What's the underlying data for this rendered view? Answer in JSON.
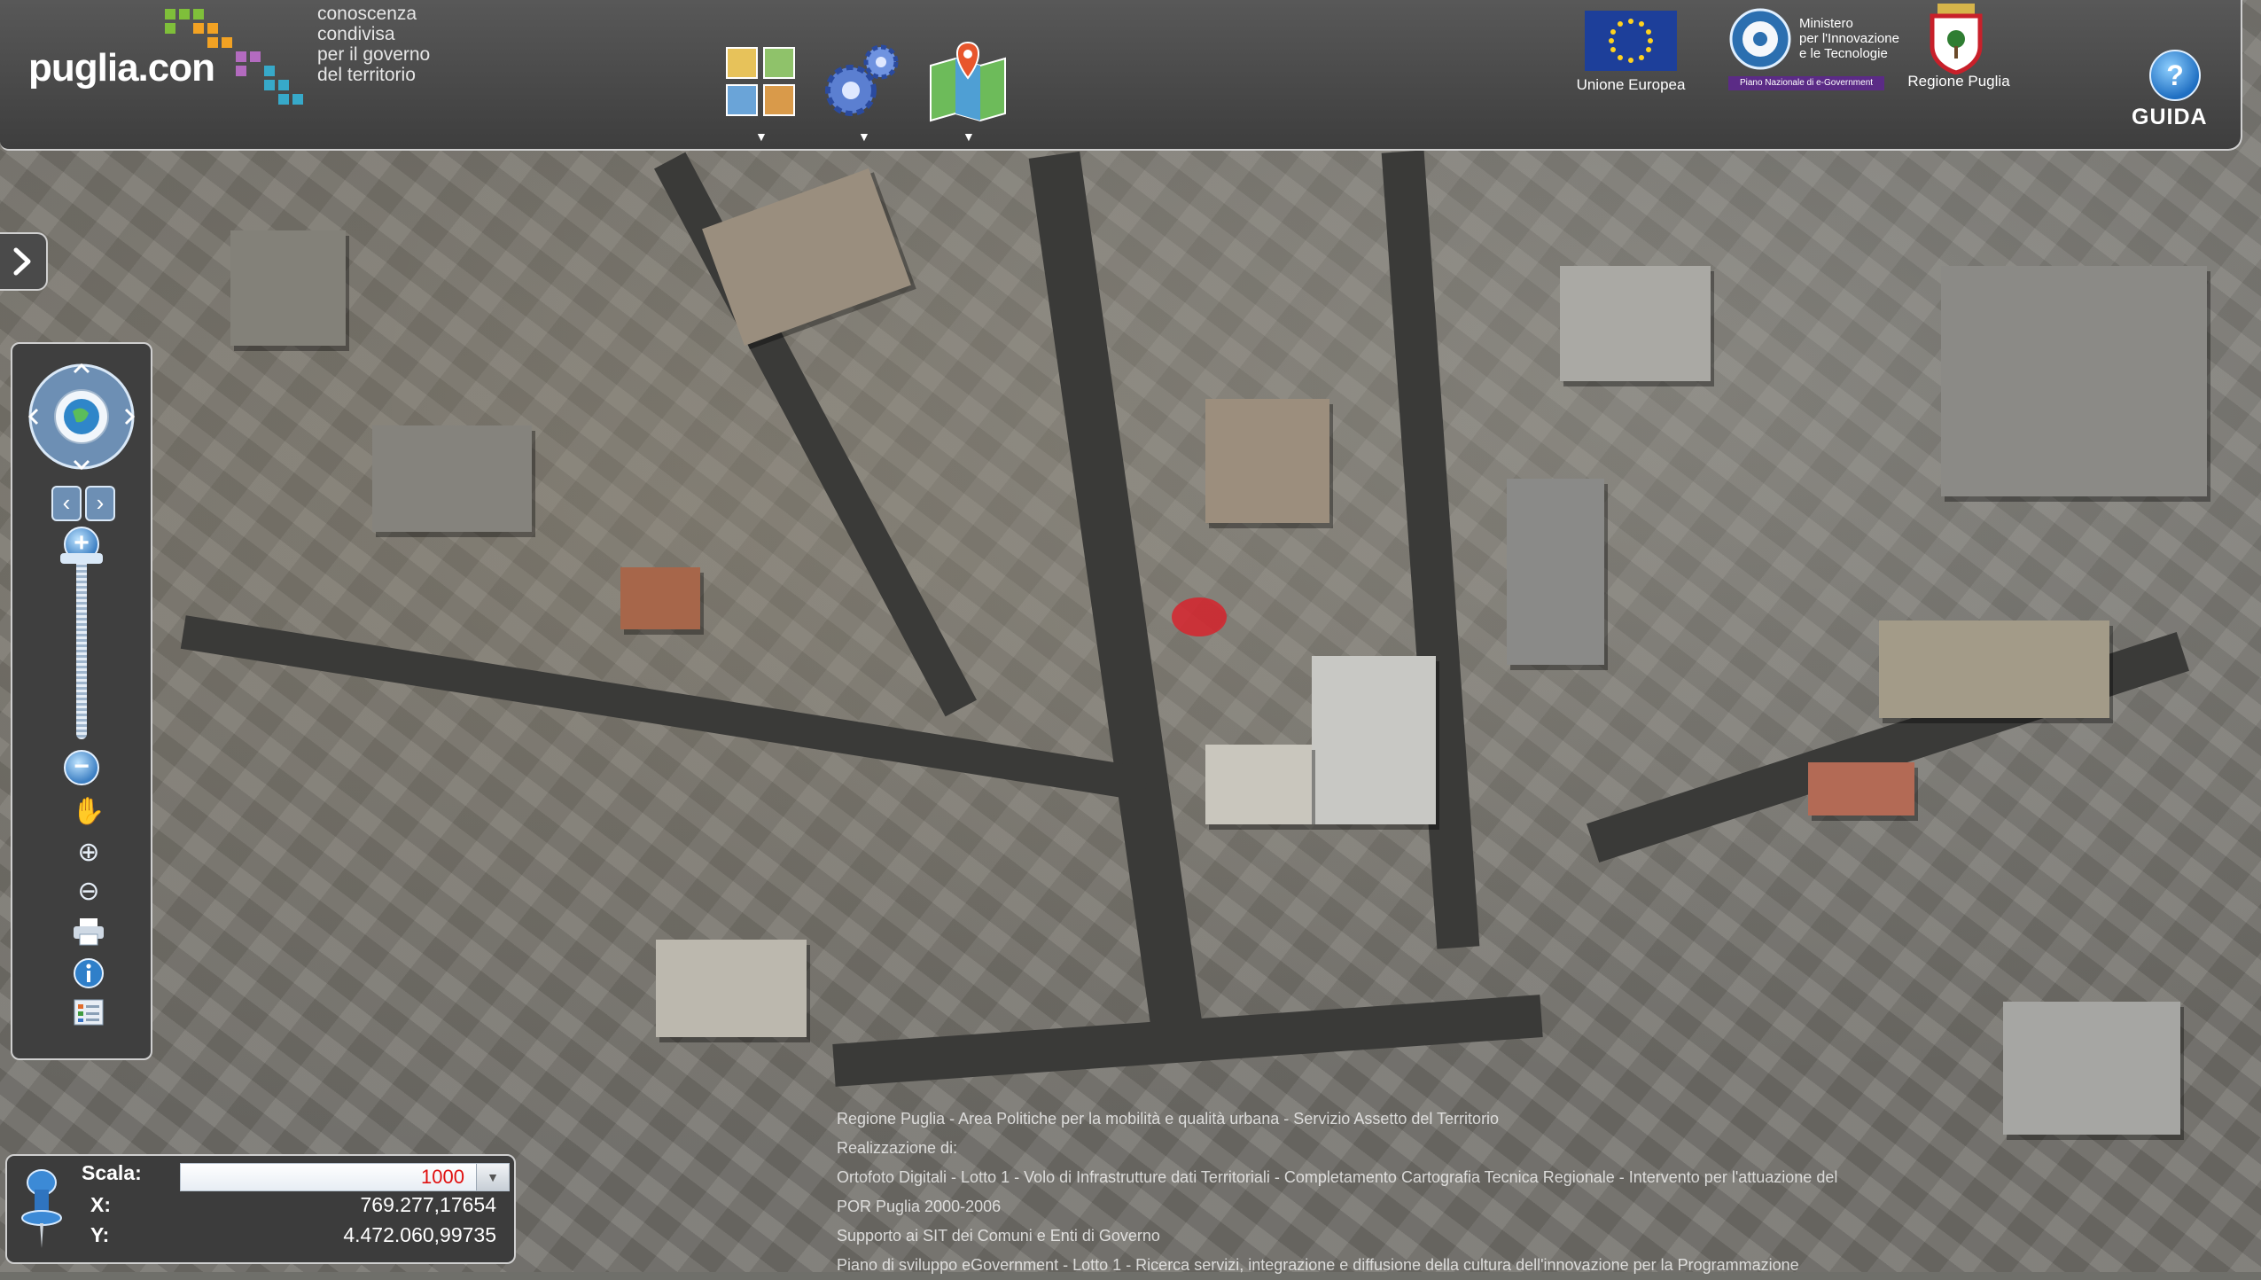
{
  "header": {
    "logo_text": "puglia.con",
    "tagline_lines": [
      "conoscenza",
      "condivisa",
      "per il governo",
      "del territorio"
    ],
    "tools": [
      {
        "name": "layers-icon",
        "arrow": "▼"
      },
      {
        "name": "gears-icon",
        "arrow": "▼"
      },
      {
        "name": "map-pin-icon",
        "arrow": "▼"
      }
    ],
    "partners": {
      "eu": "Unione Europea",
      "ministry_lines": [
        "Ministero",
        "per l'Innovazione",
        "e le Tecnologie"
      ],
      "ministry_band": "Piano Nazionale di e-Government",
      "region": "Regione Puglia"
    },
    "help_label": "GUIDA",
    "help_icon_glyph": "?"
  },
  "attribution_lines": [
    "Regione Puglia - Area Politiche per la mobilità e qualità urbana - Servizio Assetto del Territorio",
    "Realizzazione di:",
    "Ortofoto Digitali - Lotto 1 - Volo di Infrastrutture dati Territoriali - Completamento Cartografia Tecnica Regionale - Intervento per l'attuazione del POR Puglia 2000-2006",
    "Supporto ai SIT dei Comuni e Enti di Governo",
    "Piano di sviluppo eGovernment - Lotto 1 - Ricerca servizi, integrazione e diffusione della cultura dell'innovazione per la Programmazione"
  ],
  "scale_panel": {
    "scale_label": "Scala:",
    "scale_value": "1000",
    "x_label": "X:",
    "x_value": "769.277,17654",
    "y_label": "Y:",
    "y_value": "4.472.060,99735"
  },
  "colors": {
    "header_bg": "#4a4a4a",
    "panel_border": "#cfcfcf",
    "scale_value": "#e01010",
    "marker": "#dc1e28",
    "accent_blue": "#3c7fc3"
  }
}
